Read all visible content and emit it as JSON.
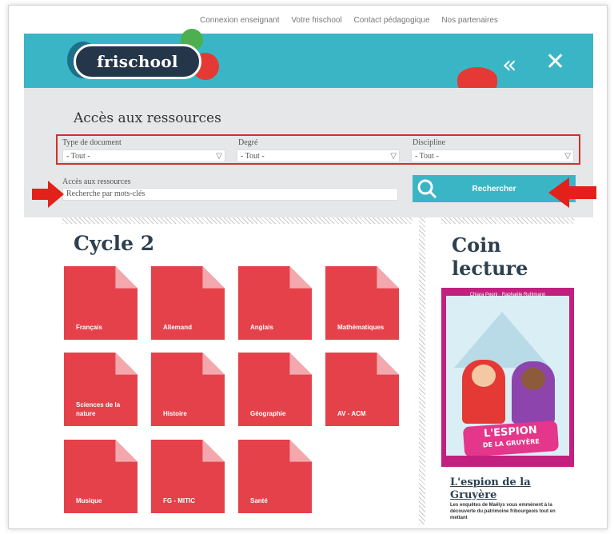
{
  "colors": {
    "header": "#3ab5c6",
    "logo_bg": "#26364a",
    "tile": "#e5414b",
    "tile_fold": "#f3a8ad",
    "highlight_border": "#d32f2f",
    "arrow": "#e3211b",
    "book_cover": "#c2207e",
    "title_text": "#2d4050"
  },
  "header": {
    "top_links": [
      "Connexion enseignant",
      "Votre frischool",
      "Contact pédagogique",
      "Nos partenaires"
    ],
    "logo_text": "frischool",
    "back_icon": "double-chevron-left-icon",
    "close_icon": "close-icon"
  },
  "search": {
    "title": "Accès aux ressources",
    "filters": [
      {
        "label": "Type de document",
        "value": "- Tout -"
      },
      {
        "label": "Degré",
        "value": "- Tout -"
      },
      {
        "label": "Discipline",
        "value": "- Tout -"
      }
    ],
    "keyword_label": "Accès aux ressources",
    "keyword_placeholder": "Recherche par mots-clés",
    "search_button": "Rechercher",
    "search_icon": "magnifier-icon"
  },
  "cycle": {
    "title": "Cycle 2",
    "subjects": [
      "Français",
      "Allemand",
      "Anglais",
      "Mathématiques",
      "Sciences de la nature",
      "Histoire",
      "Géographie",
      "AV - ACM",
      "Musique",
      "FG - MITIC",
      "Santé"
    ]
  },
  "sidebar": {
    "title": "Coin lecture",
    "book_authors": "Chiara Pegni · Raphaële Ruhlmann",
    "book_cover_title_line1": "L'ESPION",
    "book_cover_title_line2": "DE LA GRUYÈRE",
    "book_title": "L'espion de la Gruyère",
    "book_description": "Les enquêtes de Maëlys vous emmènent à la découverte du patrimoine fribourgeois tout en mettant"
  }
}
